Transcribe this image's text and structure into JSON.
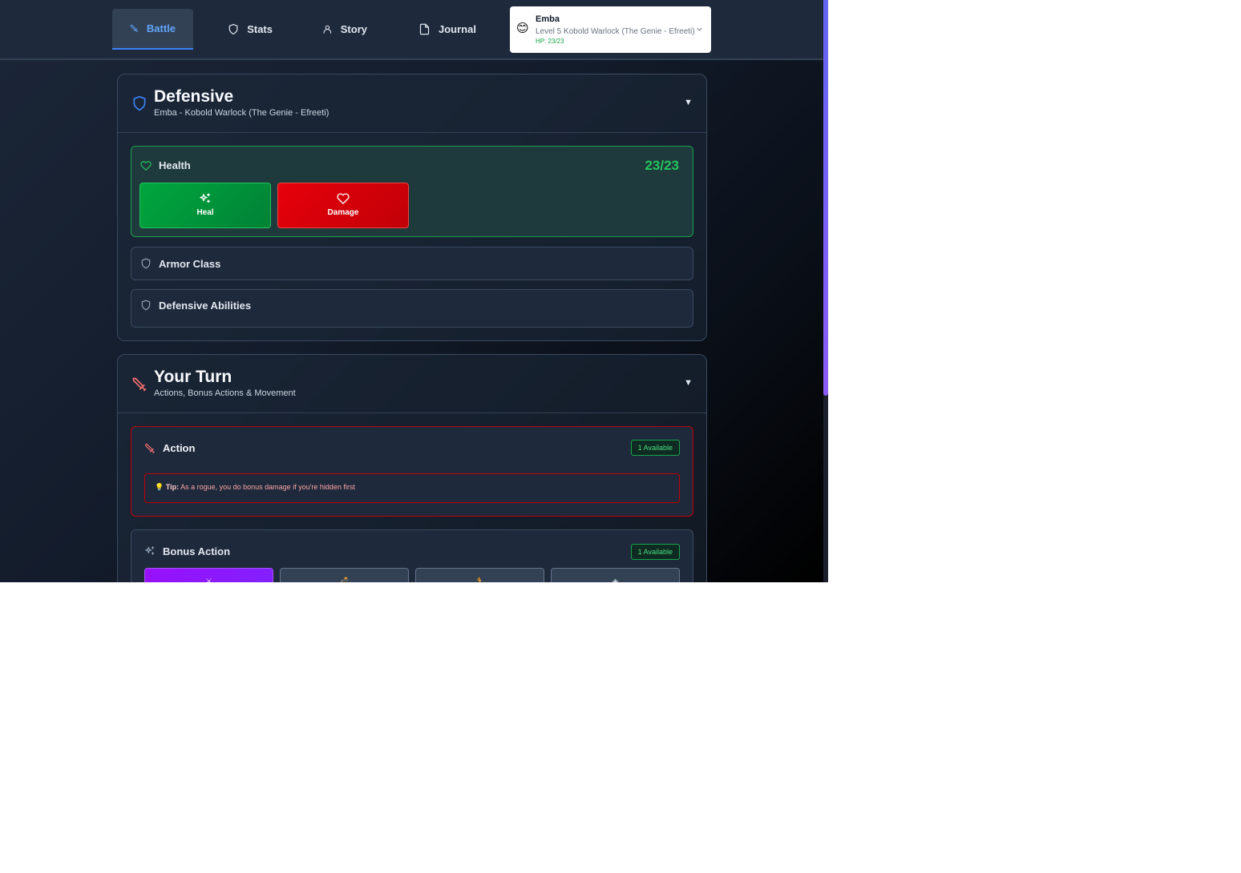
{
  "nav": {
    "tabs": [
      {
        "label": "Battle",
        "icon": "sword-icon",
        "active": true
      },
      {
        "label": "Stats",
        "icon": "shield-icon",
        "active": false
      },
      {
        "label": "Story",
        "icon": "user-icon",
        "active": false
      },
      {
        "label": "Journal",
        "icon": "file-icon",
        "active": false
      }
    ]
  },
  "character": {
    "emoji": "😊",
    "name": "Emba",
    "subtitle": "Level 5 Kobold Warlock (The Genie - Efreeti)",
    "hp": "HP: 23/23"
  },
  "defensive": {
    "title": "Defensive",
    "subtitle": "Emba - Kobold Warlock (The Genie - Efreeti)",
    "toggle": "▼",
    "health": {
      "label": "Health",
      "value": "23/23",
      "heal_label": "Heal",
      "damage_label": "Damage"
    },
    "armor_class_label": "Armor Class",
    "abilities_label": "Defensive Abilities"
  },
  "your_turn": {
    "title": "Your Turn",
    "subtitle": "Actions, Bonus Actions & Movement",
    "toggle": "▼",
    "action": {
      "label": "Action",
      "badge": "1 Available",
      "tip_prefix": "Tip:",
      "tip_text": "As a rogue, you do bonus damage if you're hidden first"
    },
    "bonus_action": {
      "label": "Bonus Action",
      "badge": "1 Available",
      "options": [
        "sword-icon",
        "bomb-icon",
        "runner-icon",
        "eye-off-icon"
      ]
    }
  },
  "colors": {
    "accent_blue": "#3b82f6",
    "health_green": "#22c55e",
    "danger_red": "#e7000b",
    "bonus_purple": "#9810fa"
  }
}
